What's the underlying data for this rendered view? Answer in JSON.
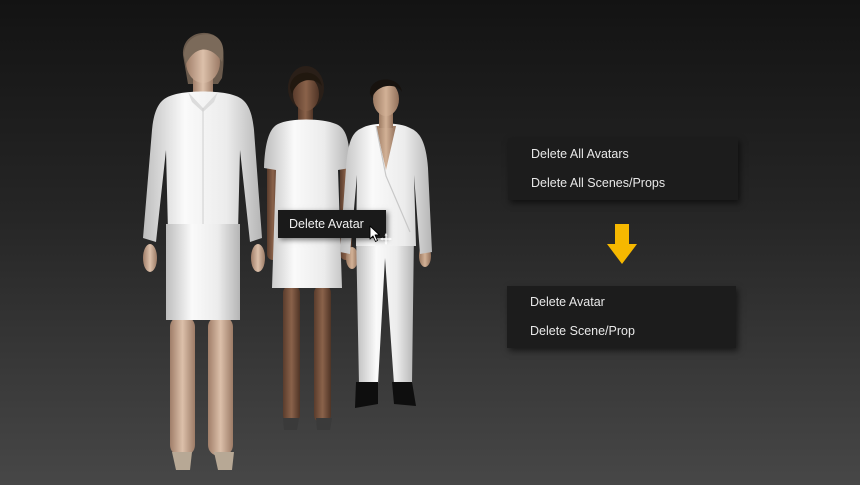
{
  "colors": {
    "menu_background": "#1c1c1c",
    "menu_text": "#e8e8e8",
    "arrow": "#f6b800",
    "garment": "#f2f2f2"
  },
  "viewport": {
    "avatars": [
      {
        "name": "woman in white shirt and skirt"
      },
      {
        "name": "woman in white dress"
      },
      {
        "name": "man in white suit"
      }
    ]
  },
  "context_menu": {
    "label": "Delete Avatar"
  },
  "menus": {
    "before": [
      {
        "label": "Delete All Avatars"
      },
      {
        "label": "Delete All Scenes/Props"
      }
    ],
    "after": [
      {
        "label": "Delete Avatar"
      },
      {
        "label": "Delete Scene/Prop"
      }
    ]
  },
  "icons": {
    "arrow": "arrow-down-icon",
    "cursor": "mouse-pointer-icon",
    "move": "move-cursor-icon"
  }
}
